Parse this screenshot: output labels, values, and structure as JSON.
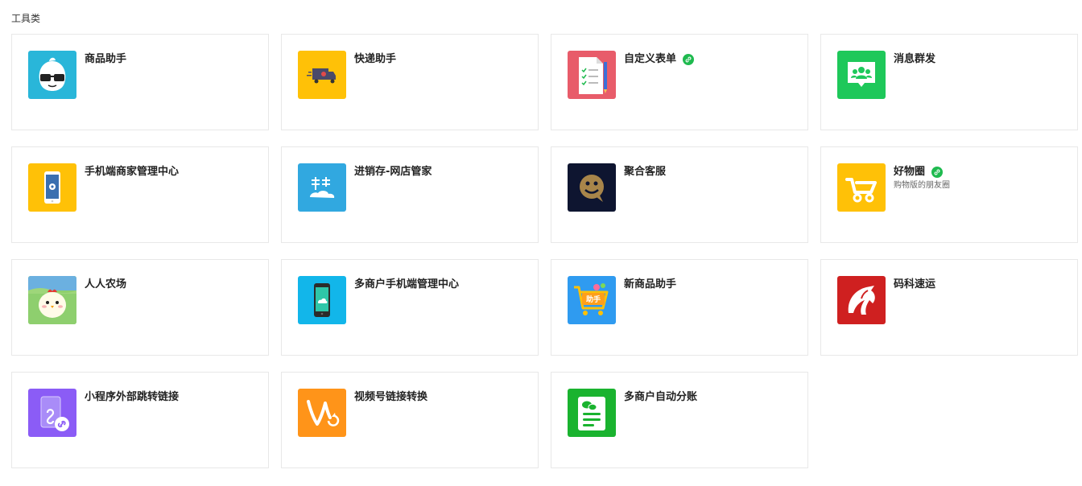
{
  "section": {
    "title": "工具类"
  },
  "colors": {
    "shop": "#29b6d9",
    "express": "#ffc107",
    "form": "#e85c6a",
    "broadcast": "#1ec85a",
    "mobile": "#ffc107",
    "inventory": "#31a8e0",
    "service": "#0e1530",
    "goodcircle": "#ffc107",
    "farm": "#8ecf6e",
    "multiMobile": "#12b6ea",
    "newShop": "#2f9bf0",
    "maike": "#cf2020",
    "miniLink": "#8b5cf6",
    "videoLink": "#ff9419",
    "split": "#1ab32f",
    "linkBadge": "#1fba4f"
  },
  "tools": [
    {
      "title": "商品助手",
      "icon": "glasses-mascot-icon"
    },
    {
      "title": "快递助手",
      "icon": "truck-icon"
    },
    {
      "title": "自定义表单",
      "icon": "form-checklist-icon",
      "badge": "link-icon"
    },
    {
      "title": "消息群发",
      "icon": "group-message-icon"
    },
    {
      "title": "手机端商家管理中心",
      "icon": "phone-gear-icon"
    },
    {
      "title": "进销存-网店管家",
      "icon": "inventory-icon"
    },
    {
      "title": "聚合客服",
      "icon": "service-face-icon"
    },
    {
      "title": "好物圈",
      "icon": "cart-icon",
      "badge": "link-icon",
      "subtitle": "购物版的朋友圈"
    },
    {
      "title": "人人农场",
      "icon": "chicken-icon"
    },
    {
      "title": "多商户手机端管理中心",
      "icon": "phone-cloud-icon"
    },
    {
      "title": "新商品助手",
      "icon": "shopping-cart-helper-icon",
      "iconText": "助手"
    },
    {
      "title": "码科速运",
      "icon": "horse-logo-icon"
    },
    {
      "title": "小程序外部跳转链接",
      "icon": "miniprogram-link-icon"
    },
    {
      "title": "视频号链接转换",
      "icon": "video-channel-icon"
    },
    {
      "title": "多商户自动分账",
      "icon": "wechat-bill-icon"
    }
  ]
}
